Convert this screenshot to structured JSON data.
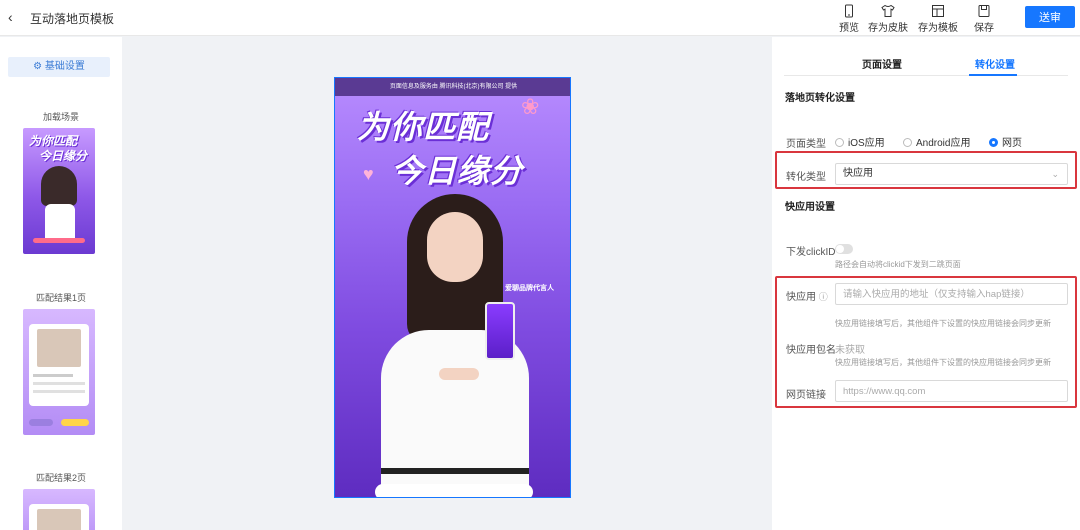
{
  "header": {
    "back_icon": "chevron-left-icon",
    "title": "互动落地页模板",
    "tools": [
      {
        "label": "预览",
        "icon": "phone-icon"
      },
      {
        "label": "存为皮肤",
        "icon": "shirt-icon"
      },
      {
        "label": "存为模板",
        "icon": "layout-icon"
      },
      {
        "label": "保存",
        "icon": "save-icon"
      }
    ],
    "submit": "送审",
    "accent": "#1677ff"
  },
  "sidebar": {
    "basic_settings": "基础设置",
    "scenes": [
      "加载场景",
      "匹配结果1页",
      "匹配结果2页"
    ]
  },
  "canvas": {
    "top_banner": "页面信息及服务由 腾讯科技(北京)有限公司 提供",
    "headline_1": "为你匹配",
    "headline_2": "今日缘分",
    "spokesperson": "爱聊品牌代言人"
  },
  "panel": {
    "tabs": [
      "页面设置",
      "转化设置"
    ],
    "active_tab": "转化设置",
    "section_conversion": "落地页转化设置",
    "page_type_label": "页面类型",
    "page_type_options": [
      "iOS应用",
      "Android应用",
      "网页"
    ],
    "page_type_selected": "网页",
    "conversion_type_label": "转化类型",
    "conversion_type_value": "快应用",
    "section_quickapp": "快应用设置",
    "clickid_label": "下发clickID",
    "clickid_hint": "路径会自动将clickid下发到二跳页面",
    "quickapp_label": "快应用",
    "quickapp_placeholder": "请输入快应用的地址（仅支持输入hap链接）",
    "quickapp_hint": "快应用链接填写后，其他组件下设置的快应用链接会同步更新",
    "package_label": "快应用包名",
    "package_value": "未获取",
    "package_hint": "快应用链接填写后，其他组件下设置的快应用链接会同步更新",
    "weblink_label": "网页链接",
    "weblink_placeholder": "https://www.qq.com",
    "highlight_color": "#d9363e"
  }
}
